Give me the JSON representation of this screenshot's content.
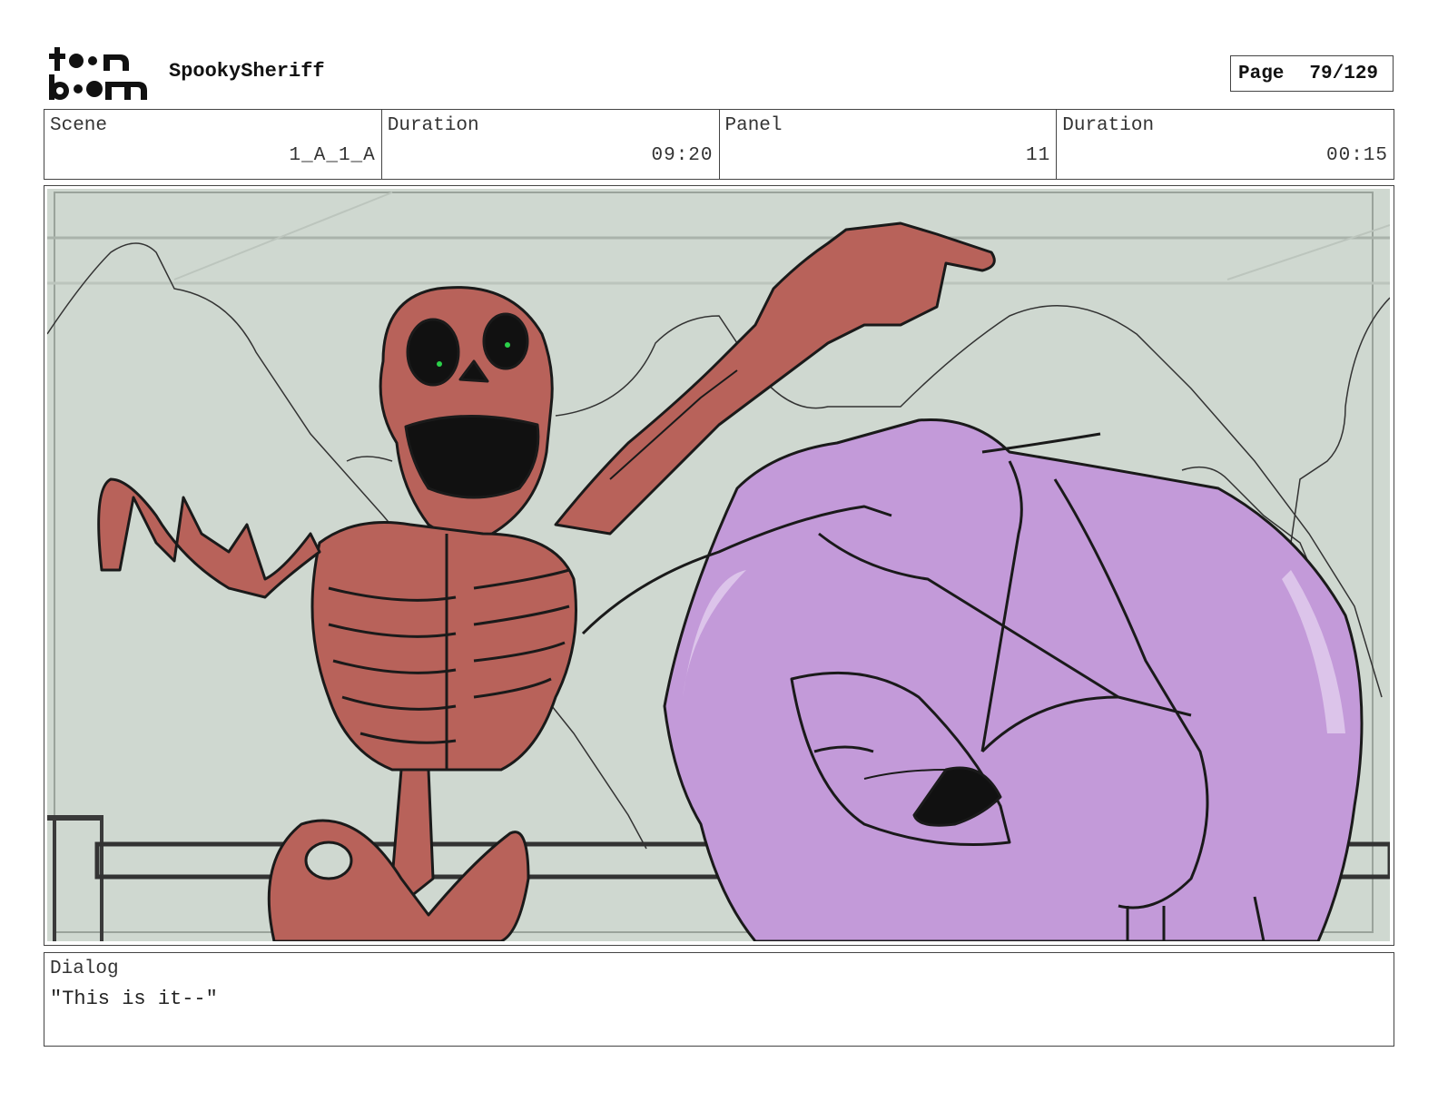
{
  "header": {
    "logo_text": "toon boom",
    "project_title": "SpookySheriff",
    "page_label": "Page",
    "page_value": "79/129"
  },
  "info": {
    "scene_label": "Scene",
    "scene_value": "1_A_1_A",
    "scene_duration_label": "Duration",
    "scene_duration_value": "09:20",
    "panel_label": "Panel",
    "panel_value": "11",
    "panel_duration_label": "Duration",
    "panel_duration_value": "00:15"
  },
  "panel_image": {
    "colors": {
      "background": "#cfd8d0",
      "skeleton": "#b8625a",
      "skeleton_shadow": "#d4938d",
      "character_hat": "#c39ad9",
      "character_hat_light": "#dcc4ea",
      "ink": "#1a1a1a"
    }
  },
  "dialog": {
    "label": "Dialog",
    "text": "\"This is it--\""
  }
}
